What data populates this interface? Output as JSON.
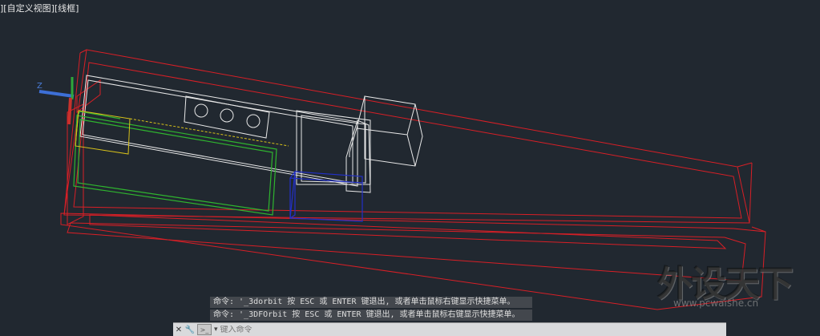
{
  "viewport": {
    "label": "][自定义视图][线框]"
  },
  "command_history": [
    "命令: '_3dorbit 按 ESC 或 ENTER 键退出, 或者单击鼠标右键显示快捷菜单。",
    "命令: '_3DFOrbit 按 ESC 或 ENTER 键退出, 或者单击鼠标右键显示快捷菜单。"
  ],
  "command_bar": {
    "placeholder": "键入命令"
  },
  "watermark": {
    "text": "外设天下",
    "url": "www.pcwaishe.cn"
  },
  "colors": {
    "background": "#212830",
    "red": "#d81f26",
    "white": "#e8e8e8",
    "green": "#2fb52f",
    "yellow": "#d8c21a",
    "blue": "#2230c8"
  },
  "icons": [
    "close-icon",
    "wrench-icon",
    "command-prompt-icon",
    "chevron-down-icon"
  ]
}
